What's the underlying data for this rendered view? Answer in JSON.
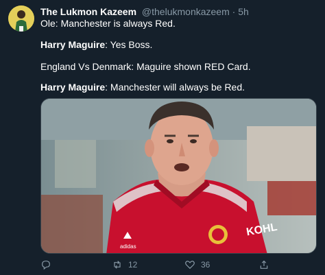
{
  "tweet": {
    "display_name": "The Lukmon Kazeem",
    "handle": "@thelukmonkazeem",
    "separator": "·",
    "time": "5h",
    "lines": [
      {
        "prefix": "",
        "text": "Ole: Manchester is always Red."
      },
      {
        "prefix": "Harry Maguire",
        "text": ": Yes Boss."
      },
      {
        "prefix": "",
        "text": "England Vs Denmark: Maguire shown RED Card."
      },
      {
        "prefix": "Harry Maguire",
        "text": ": Manchester will always be Red."
      }
    ],
    "media": {
      "description_icon": "photo",
      "shirt_sponsor": "KOHL",
      "shirt_brand": "adidas"
    },
    "actions": {
      "reply_count": "",
      "retweet_count": "12",
      "like_count": "36",
      "share_count": ""
    }
  },
  "colors": {
    "background": "#15202b",
    "secondary_text": "#8899a6",
    "shirt_red": "#c8102e"
  },
  "icons": [
    "reply-icon",
    "retweet-icon",
    "like-icon",
    "share-icon"
  ]
}
